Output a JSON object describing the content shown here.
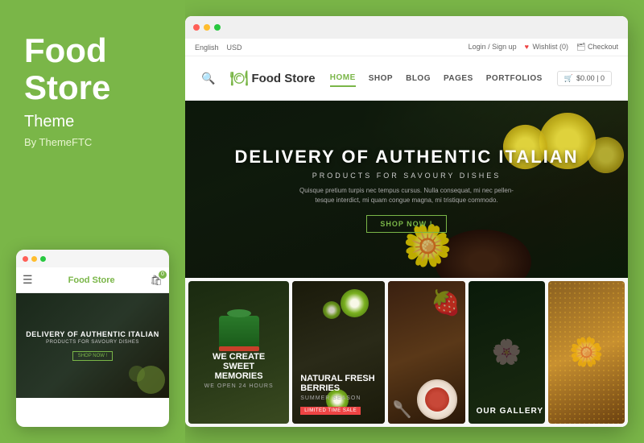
{
  "left": {
    "title_line1": "Food",
    "title_line2": "Store",
    "subtitle": "Theme",
    "by": "By ThemeFTC"
  },
  "mobile": {
    "logo": "Food Store",
    "cart_count": "0",
    "hero_title": "DELIVERY OF AUTHENTIC ITALIAN",
    "hero_sub": "PRODUCTS FOR SAVOURY DISHES",
    "shop_btn": "SHOP NOW !"
  },
  "browser": {
    "topbar": {
      "english": "English",
      "usd": "USD",
      "login": "Login / Sign up",
      "wishlist": "Wishlist (0)",
      "checkout": "Checkout"
    },
    "header": {
      "logo": "Food Store",
      "nav": [
        {
          "label": "HOME",
          "active": true
        },
        {
          "label": "SHOP",
          "active": false
        },
        {
          "label": "BLOG",
          "active": false
        },
        {
          "label": "PAGES",
          "active": false
        },
        {
          "label": "PORTFOLIOS",
          "active": false
        }
      ],
      "cart": "$0.00 | 0"
    },
    "hero": {
      "title": "DELIVERY OF AUTHENTIC ITALIAN",
      "subtitle": "PRODUCTS FOR SAVOURY DISHES",
      "desc": "Quisque pretium turpis nec tempus cursus. Nulla consequat, mi nec pellen-tesque interdict, mi quam congue magna, mi tristique commodo.",
      "cta": "SHOP NOW !"
    },
    "cards": {
      "card1_title": "WE CREATE SWEET MEMORIES",
      "card1_sub": "WE OPEN 24 HOURS",
      "card2_title": "NATURAL FRESH BERRIES",
      "card2_sub": "SUMMER SEASON",
      "card2_badge": "Limited time sale",
      "card3_gallery": "OUR GALLERY"
    }
  }
}
